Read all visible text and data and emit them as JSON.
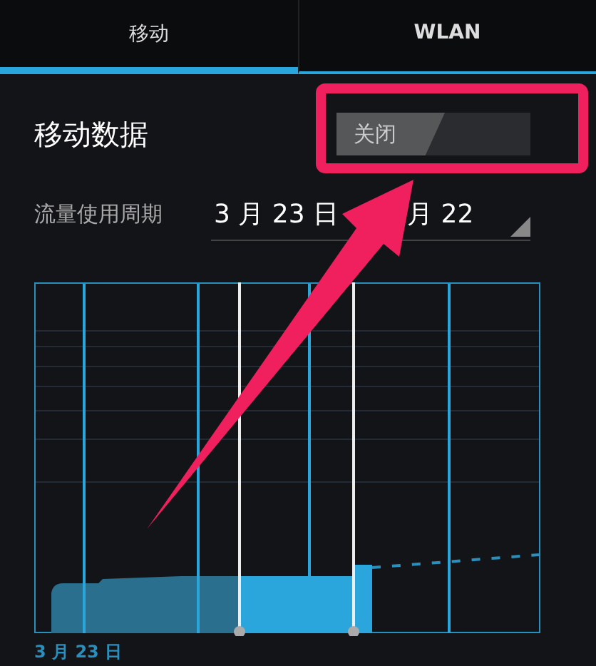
{
  "tabs": [
    {
      "label": "移动",
      "selected": true
    },
    {
      "label": "WLAN",
      "selected": false
    }
  ],
  "mobile_data": {
    "label": "移动数据",
    "switch": {
      "label": "关闭",
      "on": false
    }
  },
  "usage_cycle": {
    "label": "流量使用周期",
    "start": "3 月 23 日",
    "end": "月 22"
  },
  "usage_graph": {
    "start_label": "3 月 23 日"
  }
}
